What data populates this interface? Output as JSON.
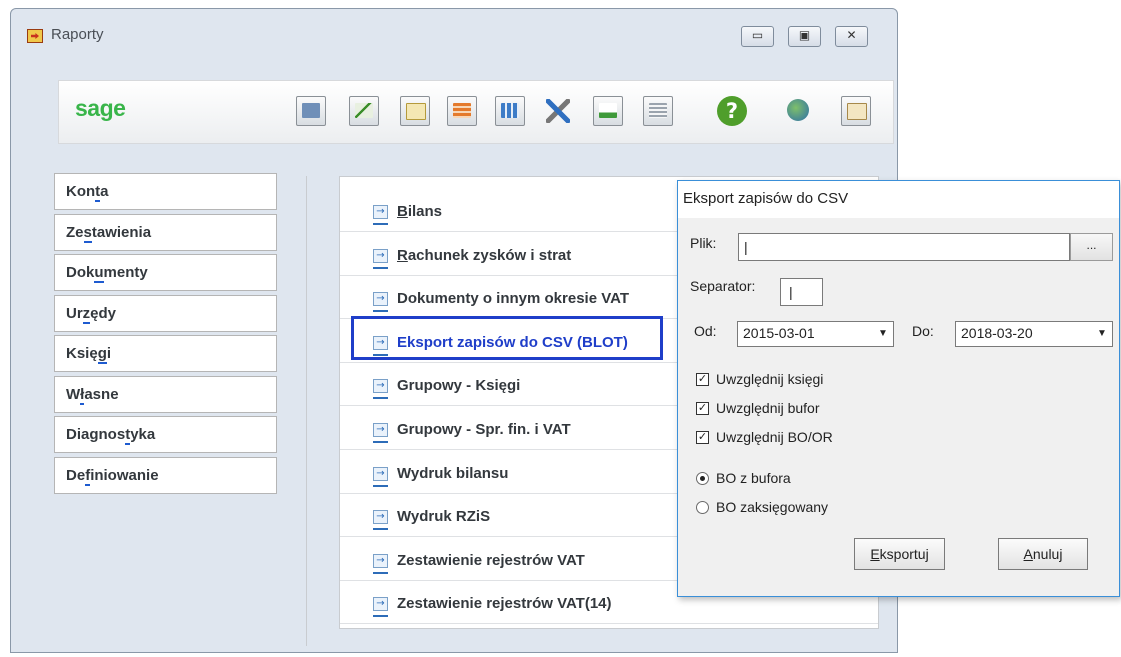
{
  "window": {
    "title": "Raporty",
    "minimize_glyph": "▭",
    "maximize_glyph": "▣",
    "close_glyph": "✕"
  },
  "toolbar": {
    "logo": "sage",
    "help_glyph": "?",
    "icons": [
      "ledger-icon",
      "chart-window-icon",
      "vat-edit-icon",
      "table-print-icon",
      "columns-icon",
      "tools-icon",
      "growth-chart-icon",
      "document-list-icon",
      "help-icon",
      "globe-mail-icon",
      "info-book-icon"
    ]
  },
  "nav": {
    "items": [
      {
        "pre": "Kon",
        "key": "t",
        "post": "a"
      },
      {
        "pre": "Ze",
        "key": "s",
        "post": "tawienia"
      },
      {
        "pre": "Dok",
        "key": "u",
        "post": "menty"
      },
      {
        "pre": "Ur",
        "key": "z",
        "post": "ędy"
      },
      {
        "pre": "Księ",
        "key": "g",
        "post": "i"
      },
      {
        "pre": "W",
        "key": "ł",
        "post": "asne"
      },
      {
        "pre": "Diagnos",
        "key": "t",
        "post": "yka"
      },
      {
        "pre": "De",
        "key": "f",
        "post": "iniowanie"
      }
    ]
  },
  "reports": {
    "arrow_glyph": "→",
    "items": [
      {
        "key": "B",
        "rest": "ilans"
      },
      {
        "key": "R",
        "rest": "achunek zysków i strat"
      },
      {
        "key": "",
        "rest": "Dokumenty o innym okresie VAT"
      },
      {
        "key": "",
        "rest": "Eksport zapisów do CSV (BLOT)"
      },
      {
        "key": "",
        "rest": "Grupowy - Księgi"
      },
      {
        "key": "",
        "rest": "Grupowy - Spr. fin. i VAT"
      },
      {
        "key": "",
        "rest": "Wydruk bilansu"
      },
      {
        "key": "",
        "rest": "Wydruk RZiS"
      },
      {
        "key": "",
        "rest": "Zestawienie rejestrów VAT"
      },
      {
        "key": "",
        "rest": "Zestawienie rejestrów VAT(14)"
      }
    ],
    "highlighted_index": 3,
    "highlight_color": "#1f3ec9"
  },
  "dialog": {
    "title": "Eksport zapisów do CSV",
    "file_label": "Plik:",
    "file_value": "|",
    "browse_label": "...",
    "separator_label": "Separator:",
    "separator_value": "|",
    "from_label": "Od:",
    "from_value": "2015-03-01",
    "to_label": "Do:",
    "to_value": "2018-03-20",
    "dropdown_glyph": "▼",
    "check_glyph": "✓",
    "checkboxes": [
      {
        "label": "Uwzględnij księgi",
        "checked": true
      },
      {
        "label": "Uwzględnij bufor",
        "checked": true
      },
      {
        "label": "Uwzględnij BO/OR",
        "checked": true
      }
    ],
    "radios": [
      {
        "label": "BO z bufora",
        "selected": true
      },
      {
        "label": "BO zaksięgowany",
        "selected": false
      }
    ],
    "export_button": {
      "key": "E",
      "rest": "ksportuj"
    },
    "cancel_button": {
      "key": "A",
      "rest": "nuluj"
    }
  }
}
